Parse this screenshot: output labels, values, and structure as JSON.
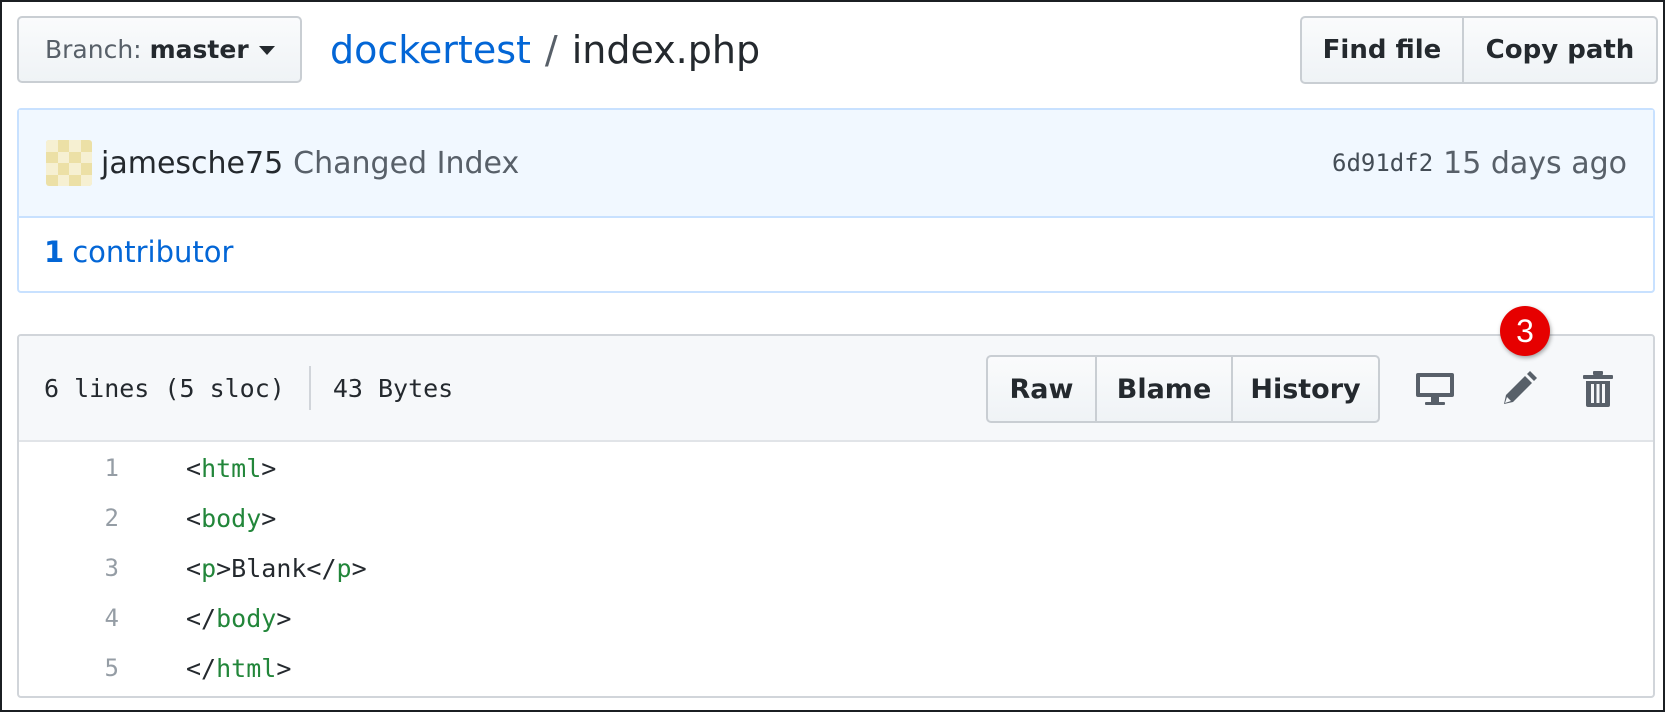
{
  "branch": {
    "label": "Branch:",
    "name": "master"
  },
  "breadcrumb": {
    "repo": "dockertest",
    "separator": "/",
    "file": "index.php"
  },
  "top_actions": {
    "find_file": "Find file",
    "copy_path": "Copy path"
  },
  "commit": {
    "author": "jamesche75",
    "message": "Changed Index",
    "sha": "6d91df2",
    "time_ago": "15 days ago"
  },
  "contributors": {
    "count": "1",
    "label": "contributor"
  },
  "file": {
    "lines_info": "6 lines (5 sloc)",
    "size": "43 Bytes",
    "actions": {
      "raw": "Raw",
      "blame": "Blame",
      "history": "History"
    },
    "icons": [
      "desktop-icon",
      "pencil-icon",
      "trash-icon"
    ]
  },
  "code_lines": [
    {
      "num": "1",
      "open": "<",
      "tag1": "html",
      "mid": ">",
      "text": "",
      "tag2": "",
      "close": ""
    },
    {
      "num": "2",
      "open": "<",
      "tag1": "body",
      "mid": ">",
      "text": "",
      "tag2": "",
      "close": ""
    },
    {
      "num": "3",
      "open": "<",
      "tag1": "p",
      "mid": ">Blank</",
      "text": "",
      "tag2": "p",
      "close": ">"
    },
    {
      "num": "4",
      "open": "</",
      "tag1": "body",
      "mid": ">",
      "text": "",
      "tag2": "",
      "close": ""
    },
    {
      "num": "5",
      "open": "</",
      "tag1": "html",
      "mid": ">",
      "text": "",
      "tag2": "",
      "close": ""
    }
  ],
  "annotation": {
    "step": "3"
  },
  "colors": {
    "link_blue": "#0366d6",
    "tag_green": "#22863a",
    "commit_bg": "#f1f8ff",
    "badge_red": "#e60000"
  }
}
